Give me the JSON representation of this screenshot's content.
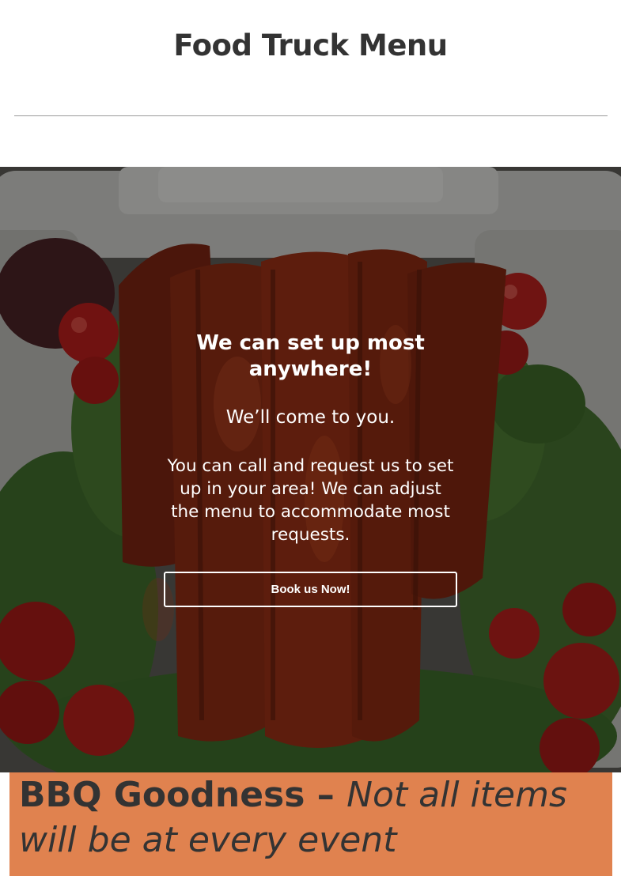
{
  "header": {
    "title": "Food Truck Menu"
  },
  "hero": {
    "heading": "We can set up most anywhere!",
    "subheading": "We’ll come to you.",
    "body": "You can call and request us to set up in your area! We can adjust the menu to accommodate most requests.",
    "button_label": "Book us Now!",
    "image_subject": "bbq-ribs-on-kale-with-tomatoes"
  },
  "menu_section": {
    "title": "BBQ Goodness",
    "separator": " – ",
    "note": "Not all items will be at every event",
    "background_color": "#e0824f"
  },
  "colors": {
    "title_text": "#333333",
    "hero_text": "#ffffff",
    "accent": "#e0824f"
  }
}
